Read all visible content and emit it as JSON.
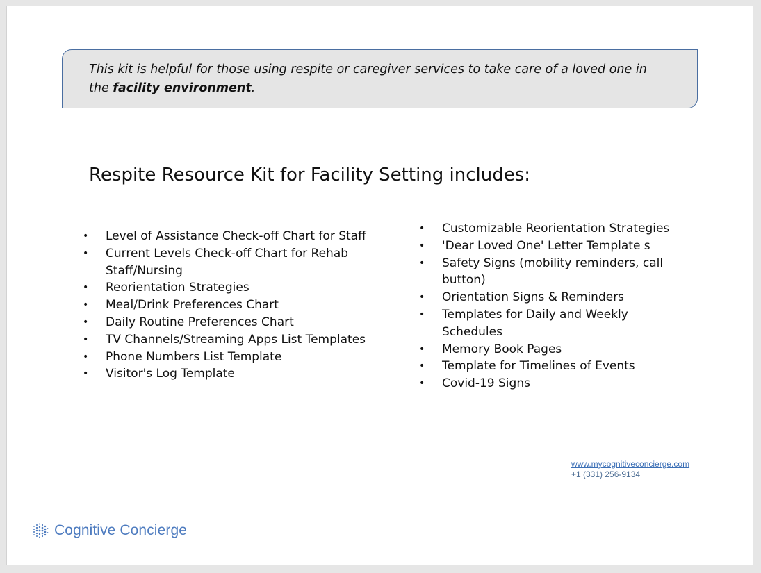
{
  "callout": {
    "text_before": "This kit is helpful for those using respite or caregiver services to take care of a loved one in the ",
    "text_bold": "facility environment",
    "text_after": "."
  },
  "kit_title": "Respite Resource Kit for Facility Setting includes:",
  "left_items": [
    "Level of Assistance Check-off Chart for Staff",
    "Current Levels Check-off Chart for Rehab Staff/Nursing",
    "Reorientation Strategies",
    "Meal/Drink Preferences Chart",
    "Daily Routine Preferences Chart",
    "TV Channels/Streaming Apps List Templates",
    "Phone Numbers List Template",
    "Visitor's Log Template"
  ],
  "right_items": [
    "Customizable Reorientation Strategies",
    "'Dear Loved One' Letter Template s",
    "Safety Signs (mobility reminders, call button)",
    "Orientation Signs & Reminders",
    "Templates for Daily and Weekly Schedules",
    "Memory Book Pages",
    "Template for Timelines of Events",
    "Covid-19 Signs"
  ],
  "contact": {
    "website": "www.mycognitiveconcierge.com",
    "phone": "+1 (331) 256-9134"
  },
  "brand": {
    "name": "Cognitive Concierge",
    "icon": "dot-grid-logo-icon",
    "color": "#4d7bbf"
  }
}
